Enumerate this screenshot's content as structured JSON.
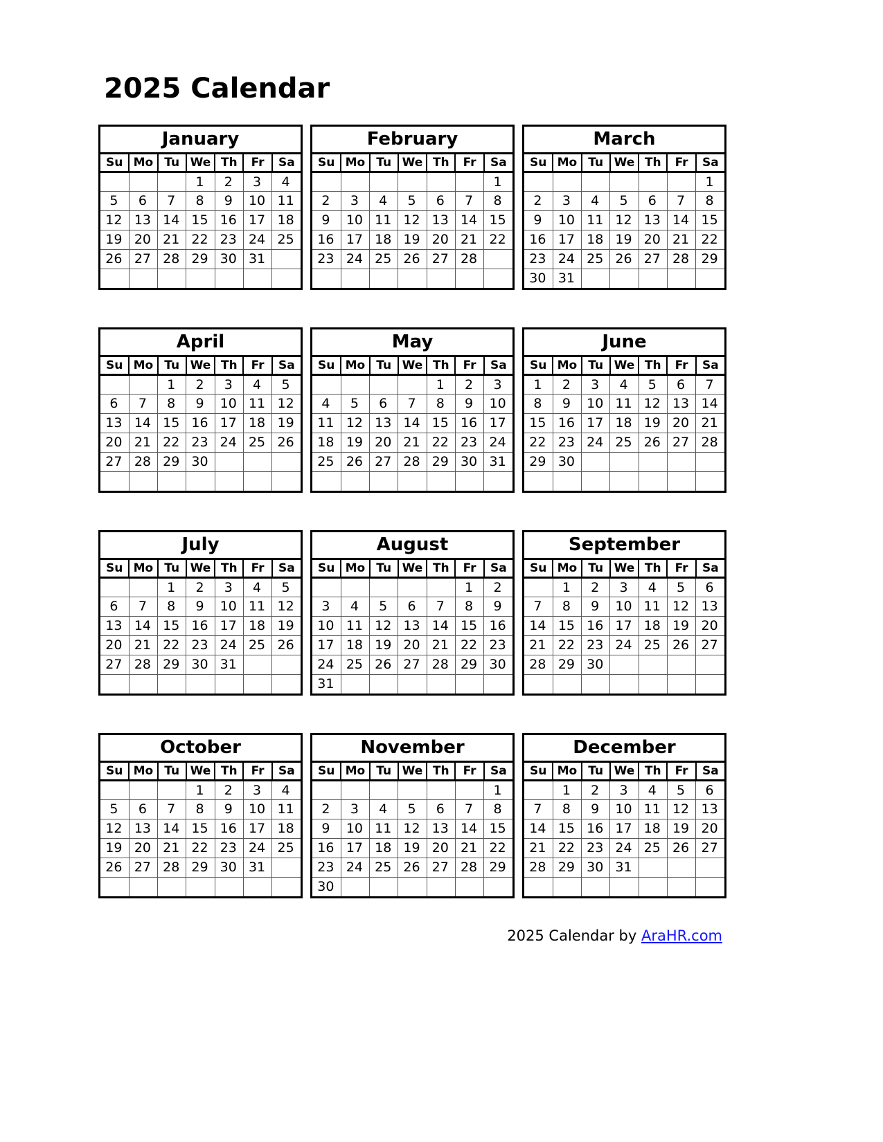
{
  "title": "2025 Calendar",
  "year": "2025",
  "weekdays": [
    "Su",
    "Mo",
    "Tu",
    "We",
    "Th",
    "Fr",
    "Sa"
  ],
  "footer": {
    "prefix": "2025  Calendar by ",
    "link": "AraHR.com",
    "link_color": "#1414ff"
  },
  "months": [
    {
      "name": "January",
      "weeks": [
        [
          "",
          "",
          "",
          "1",
          "2",
          "3",
          "4"
        ],
        [
          "5",
          "6",
          "7",
          "8",
          "9",
          "10",
          "11"
        ],
        [
          "12",
          "13",
          "14",
          "15",
          "16",
          "17",
          "18"
        ],
        [
          "19",
          "20",
          "21",
          "22",
          "23",
          "24",
          "25"
        ],
        [
          "26",
          "27",
          "28",
          "29",
          "30",
          "31",
          ""
        ],
        [
          "",
          "",
          "",
          "",
          "",
          "",
          ""
        ]
      ]
    },
    {
      "name": "February",
      "weeks": [
        [
          "",
          "",
          "",
          "",
          "",
          "",
          "1"
        ],
        [
          "2",
          "3",
          "4",
          "5",
          "6",
          "7",
          "8"
        ],
        [
          "9",
          "10",
          "11",
          "12",
          "13",
          "14",
          "15"
        ],
        [
          "16",
          "17",
          "18",
          "19",
          "20",
          "21",
          "22"
        ],
        [
          "23",
          "24",
          "25",
          "26",
          "27",
          "28",
          ""
        ],
        [
          "",
          "",
          "",
          "",
          "",
          "",
          ""
        ]
      ]
    },
    {
      "name": "March",
      "weeks": [
        [
          "",
          "",
          "",
          "",
          "",
          "",
          "1"
        ],
        [
          "2",
          "3",
          "4",
          "5",
          "6",
          "7",
          "8"
        ],
        [
          "9",
          "10",
          "11",
          "12",
          "13",
          "14",
          "15"
        ],
        [
          "16",
          "17",
          "18",
          "19",
          "20",
          "21",
          "22"
        ],
        [
          "23",
          "24",
          "25",
          "26",
          "27",
          "28",
          "29"
        ],
        [
          "30",
          "31",
          "",
          "",
          "",
          "",
          ""
        ]
      ]
    },
    {
      "name": "April",
      "weeks": [
        [
          "",
          "",
          "1",
          "2",
          "3",
          "4",
          "5"
        ],
        [
          "6",
          "7",
          "8",
          "9",
          "10",
          "11",
          "12"
        ],
        [
          "13",
          "14",
          "15",
          "16",
          "17",
          "18",
          "19"
        ],
        [
          "20",
          "21",
          "22",
          "23",
          "24",
          "25",
          "26"
        ],
        [
          "27",
          "28",
          "29",
          "30",
          "",
          "",
          ""
        ],
        [
          "",
          "",
          "",
          "",
          "",
          "",
          ""
        ]
      ]
    },
    {
      "name": "May",
      "weeks": [
        [
          "",
          "",
          "",
          "",
          "1",
          "2",
          "3"
        ],
        [
          "4",
          "5",
          "6",
          "7",
          "8",
          "9",
          "10"
        ],
        [
          "11",
          "12",
          "13",
          "14",
          "15",
          "16",
          "17"
        ],
        [
          "18",
          "19",
          "20",
          "21",
          "22",
          "23",
          "24"
        ],
        [
          "25",
          "26",
          "27",
          "28",
          "29",
          "30",
          "31"
        ],
        [
          "",
          "",
          "",
          "",
          "",
          "",
          ""
        ]
      ]
    },
    {
      "name": "June",
      "weeks": [
        [
          "1",
          "2",
          "3",
          "4",
          "5",
          "6",
          "7"
        ],
        [
          "8",
          "9",
          "10",
          "11",
          "12",
          "13",
          "14"
        ],
        [
          "15",
          "16",
          "17",
          "18",
          "19",
          "20",
          "21"
        ],
        [
          "22",
          "23",
          "24",
          "25",
          "26",
          "27",
          "28"
        ],
        [
          "29",
          "30",
          "",
          "",
          "",
          "",
          ""
        ],
        [
          "",
          "",
          "",
          "",
          "",
          "",
          ""
        ]
      ]
    },
    {
      "name": "July",
      "weeks": [
        [
          "",
          "",
          "1",
          "2",
          "3",
          "4",
          "5"
        ],
        [
          "6",
          "7",
          "8",
          "9",
          "10",
          "11",
          "12"
        ],
        [
          "13",
          "14",
          "15",
          "16",
          "17",
          "18",
          "19"
        ],
        [
          "20",
          "21",
          "22",
          "23",
          "24",
          "25",
          "26"
        ],
        [
          "27",
          "28",
          "29",
          "30",
          "31",
          "",
          ""
        ],
        [
          "",
          "",
          "",
          "",
          "",
          "",
          ""
        ]
      ]
    },
    {
      "name": "August",
      "weeks": [
        [
          "",
          "",
          "",
          "",
          "",
          "1",
          "2"
        ],
        [
          "3",
          "4",
          "5",
          "6",
          "7",
          "8",
          "9"
        ],
        [
          "10",
          "11",
          "12",
          "13",
          "14",
          "15",
          "16"
        ],
        [
          "17",
          "18",
          "19",
          "20",
          "21",
          "22",
          "23"
        ],
        [
          "24",
          "25",
          "26",
          "27",
          "28",
          "29",
          "30"
        ],
        [
          "31",
          "",
          "",
          "",
          "",
          "",
          ""
        ]
      ]
    },
    {
      "name": "September",
      "weeks": [
        [
          "",
          "1",
          "2",
          "3",
          "4",
          "5",
          "6"
        ],
        [
          "7",
          "8",
          "9",
          "10",
          "11",
          "12",
          "13"
        ],
        [
          "14",
          "15",
          "16",
          "17",
          "18",
          "19",
          "20"
        ],
        [
          "21",
          "22",
          "23",
          "24",
          "25",
          "26",
          "27"
        ],
        [
          "28",
          "29",
          "30",
          "",
          "",
          "",
          ""
        ],
        [
          "",
          "",
          "",
          "",
          "",
          "",
          ""
        ]
      ]
    },
    {
      "name": "October",
      "weeks": [
        [
          "",
          "",
          "",
          "1",
          "2",
          "3",
          "4"
        ],
        [
          "5",
          "6",
          "7",
          "8",
          "9",
          "10",
          "11"
        ],
        [
          "12",
          "13",
          "14",
          "15",
          "16",
          "17",
          "18"
        ],
        [
          "19",
          "20",
          "21",
          "22",
          "23",
          "24",
          "25"
        ],
        [
          "26",
          "27",
          "28",
          "29",
          "30",
          "31",
          ""
        ],
        [
          "",
          "",
          "",
          "",
          "",
          "",
          ""
        ]
      ]
    },
    {
      "name": "November",
      "weeks": [
        [
          "",
          "",
          "",
          "",
          "",
          "",
          "1"
        ],
        [
          "2",
          "3",
          "4",
          "5",
          "6",
          "7",
          "8"
        ],
        [
          "9",
          "10",
          "11",
          "12",
          "13",
          "14",
          "15"
        ],
        [
          "16",
          "17",
          "18",
          "19",
          "20",
          "21",
          "22"
        ],
        [
          "23",
          "24",
          "25",
          "26",
          "27",
          "28",
          "29"
        ],
        [
          "30",
          "",
          "",
          "",
          "",
          "",
          ""
        ]
      ]
    },
    {
      "name": "December",
      "weeks": [
        [
          "",
          "1",
          "2",
          "3",
          "4",
          "5",
          "6"
        ],
        [
          "7",
          "8",
          "9",
          "10",
          "11",
          "12",
          "13"
        ],
        [
          "14",
          "15",
          "16",
          "17",
          "18",
          "19",
          "20"
        ],
        [
          "21",
          "22",
          "23",
          "24",
          "25",
          "26",
          "27"
        ],
        [
          "28",
          "29",
          "30",
          "31",
          "",
          "",
          ""
        ],
        [
          "",
          "",
          "",
          "",
          "",
          "",
          ""
        ]
      ]
    }
  ]
}
